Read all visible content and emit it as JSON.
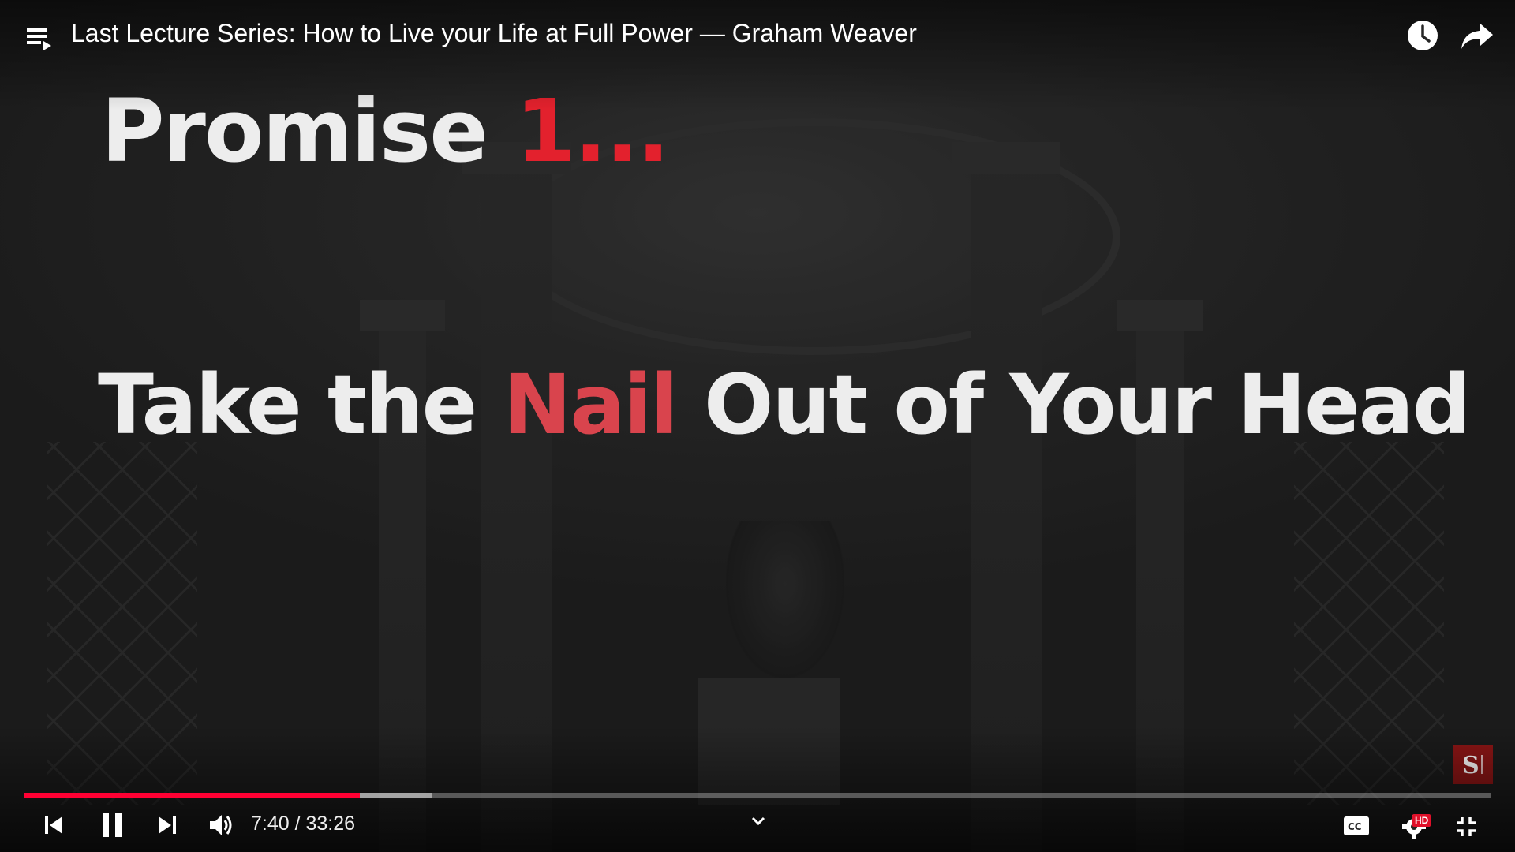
{
  "window": {
    "title": "Last Lecture Series: How to Live your Life at Full Power — Graham Weaver"
  },
  "slide": {
    "heading_prefix": "Promise ",
    "heading_highlight": "1...",
    "main_prefix": "Take the ",
    "main_highlight": "Nail",
    "main_suffix": " Out of Your Head"
  },
  "player": {
    "current_time": "7:40",
    "duration": "33:26",
    "time_text": "7:40 / 33:26",
    "progress_fraction": 0.2293,
    "buffer_fraction": 0.278,
    "quality_badge": "HD",
    "accent_color": "#ff0033",
    "highlight_color": "#e3212d"
  },
  "icons": {
    "playlist": "playlist-icon",
    "watch_later": "clock-icon",
    "share": "share-icon",
    "previous": "skip-previous-icon",
    "pause": "pause-icon",
    "next": "skip-next-icon",
    "volume": "volume-icon",
    "expand": "chevron-down-icon",
    "captions": "cc-icon",
    "settings": "gear-icon",
    "fullscreen_exit": "fullscreen-exit-icon",
    "logo": "stanford-business-logo"
  }
}
